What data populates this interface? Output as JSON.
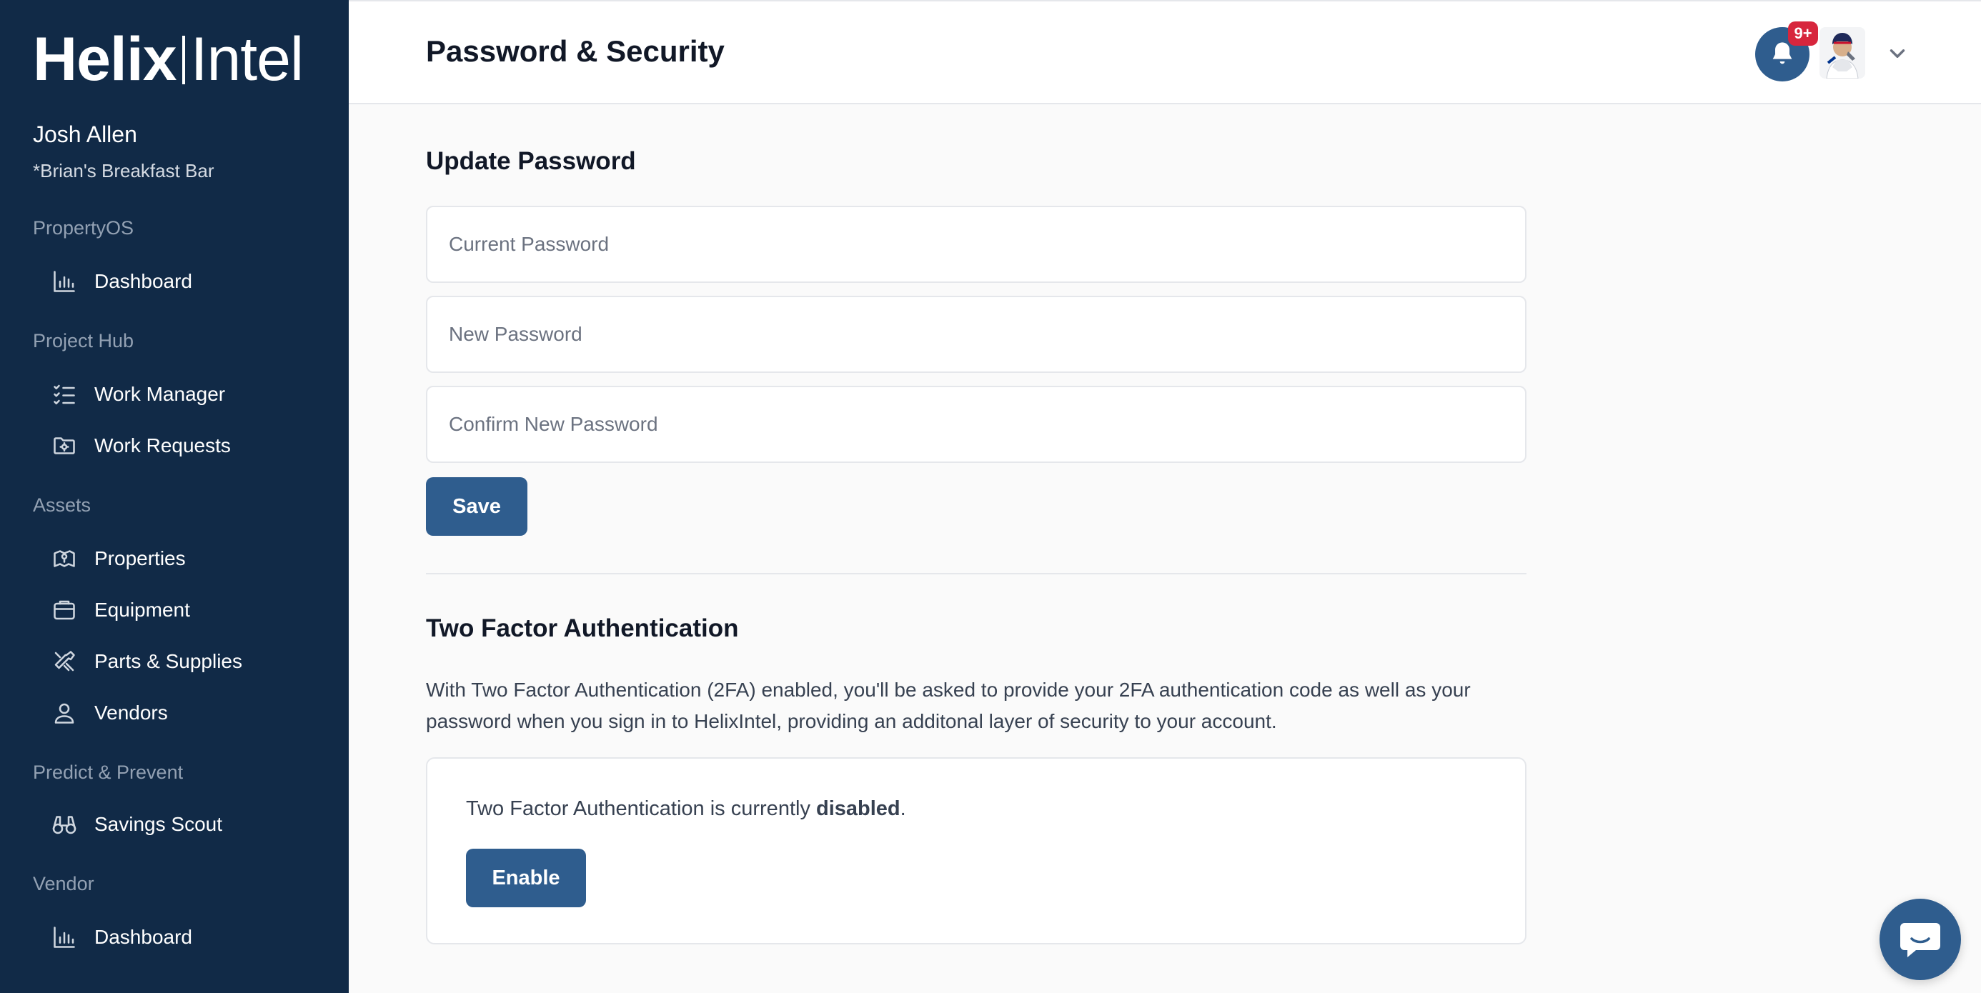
{
  "brand": {
    "part1": "Helix",
    "part2": "Intel"
  },
  "user": {
    "name": "Josh Allen",
    "org": "*Brian's Breakfast Bar"
  },
  "sidebar": {
    "sections": [
      {
        "title": "PropertyOS",
        "items": [
          {
            "label": "Dashboard",
            "icon": "bar-chart-icon"
          }
        ]
      },
      {
        "title": "Project Hub",
        "items": [
          {
            "label": "Work Manager",
            "icon": "checklist-icon"
          },
          {
            "label": "Work Requests",
            "icon": "folder-gear-icon"
          }
        ]
      },
      {
        "title": "Assets",
        "items": [
          {
            "label": "Properties",
            "icon": "map-pin-icon"
          },
          {
            "label": "Equipment",
            "icon": "box-icon"
          },
          {
            "label": "Parts & Supplies",
            "icon": "tools-icon"
          },
          {
            "label": "Vendors",
            "icon": "person-icon"
          }
        ]
      },
      {
        "title": "Predict & Prevent",
        "items": [
          {
            "label": "Savings Scout",
            "icon": "binoculars-icon"
          }
        ]
      },
      {
        "title": "Vendor",
        "items": [
          {
            "label": "Dashboard",
            "icon": "bar-chart-icon"
          }
        ]
      }
    ]
  },
  "header": {
    "title": "Password & Security",
    "notification_badge": "9+"
  },
  "update_password": {
    "heading": "Update Password",
    "current_placeholder": "Current Password",
    "new_placeholder": "New Password",
    "confirm_placeholder": "Confirm New Password",
    "save_label": "Save"
  },
  "two_factor": {
    "heading": "Two Factor Authentication",
    "description": "With Two Factor Authentication (2FA) enabled, you'll be asked to provide your 2FA authentication code as well as your password when you sign in to HelixIntel, providing an additonal layer of security to your account.",
    "status_prefix": "Two Factor Authentication is currently ",
    "status_value": "disabled",
    "status_suffix": ".",
    "enable_label": "Enable"
  },
  "colors": {
    "sidebar_bg": "#112a47",
    "primary": "#2f5d8e",
    "badge": "#d7263d",
    "page_bg": "#fafafa"
  }
}
